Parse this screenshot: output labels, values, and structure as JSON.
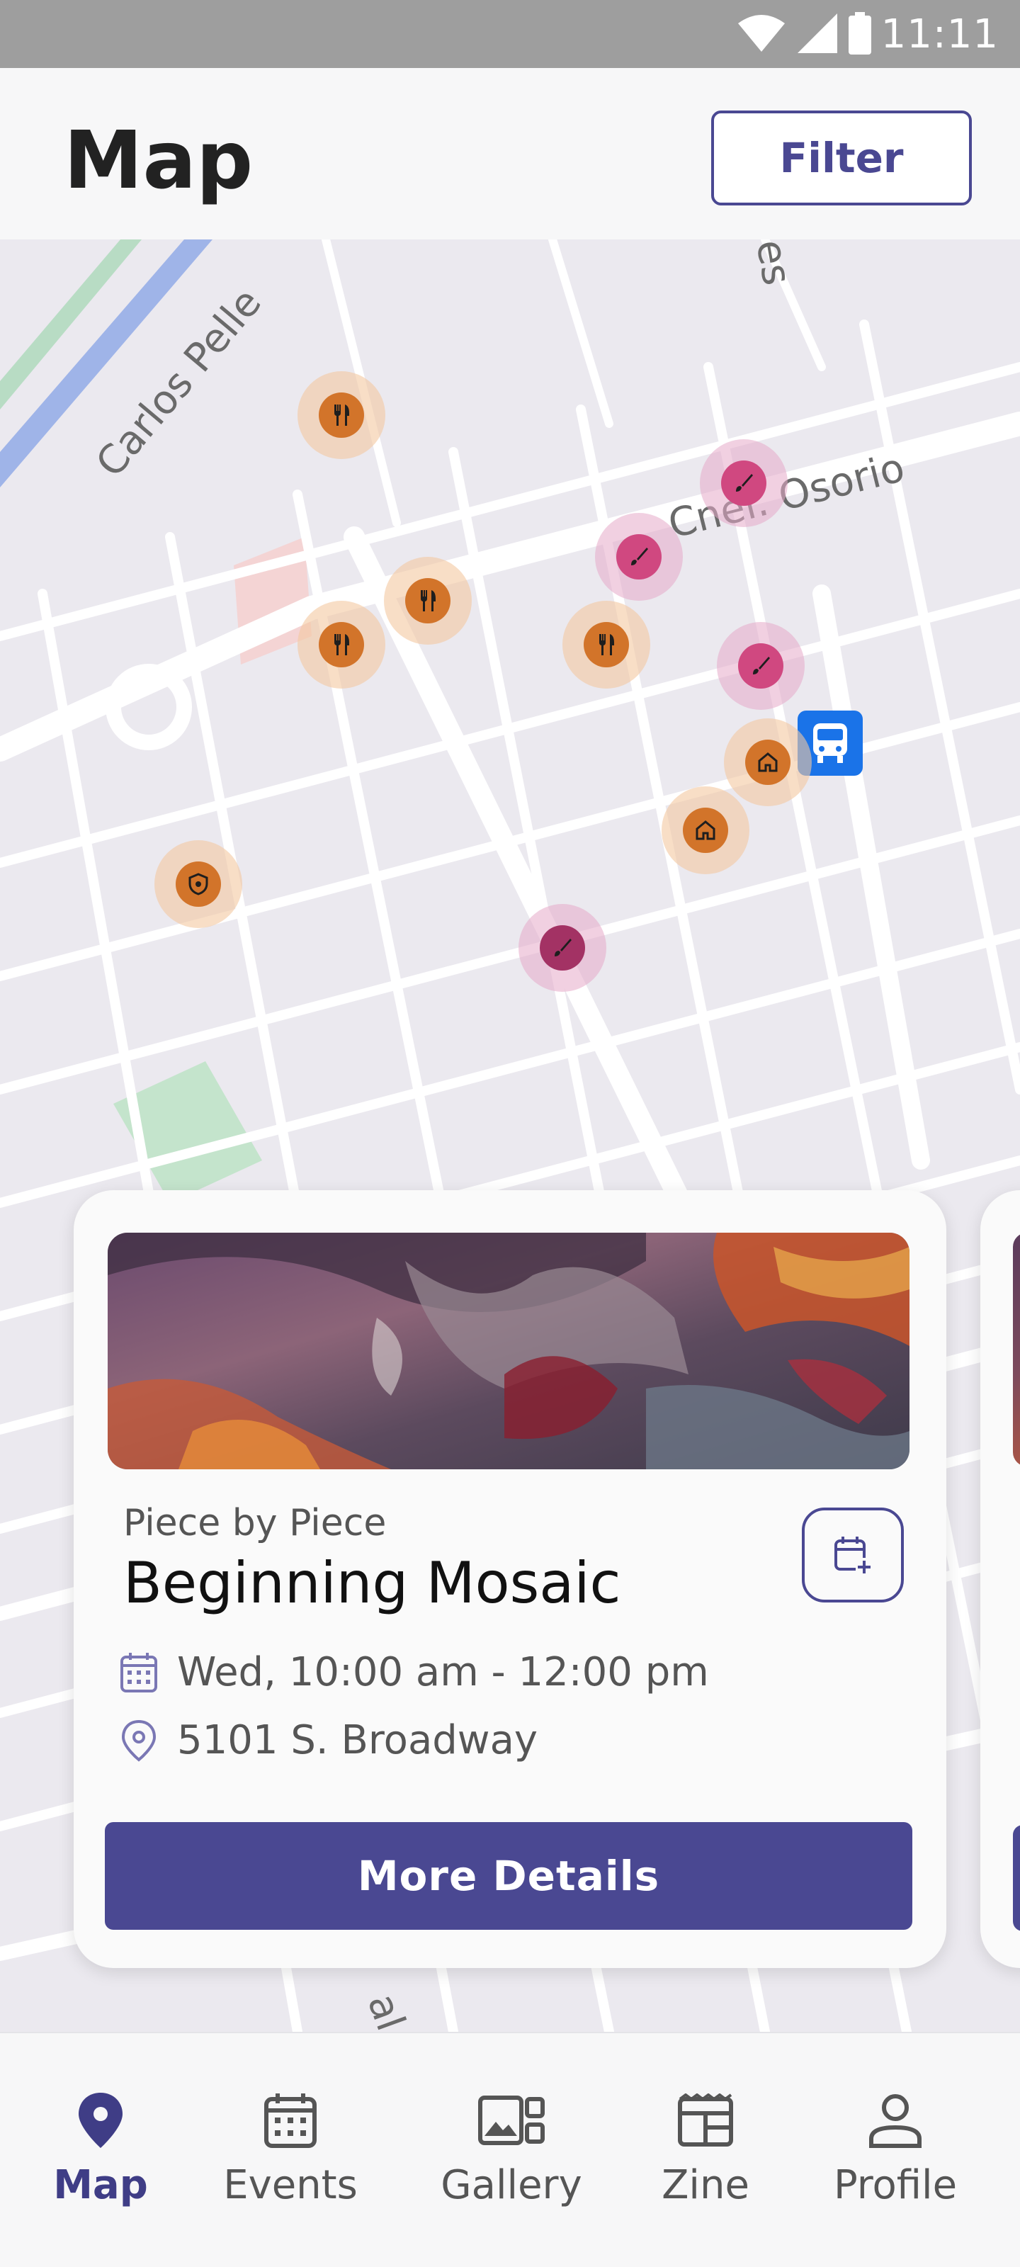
{
  "status_bar": {
    "time": "11:11",
    "icons": [
      "wifi-icon",
      "signal-icon",
      "battery-icon"
    ]
  },
  "header": {
    "title": "Map",
    "filter_label": "Filter"
  },
  "map": {
    "street_labels": [
      "Carlos Pelle",
      "Cnel. Osorio",
      "es",
      "al"
    ],
    "pins": [
      {
        "type": "food",
        "icon": "fork-knife-icon"
      },
      {
        "type": "art",
        "icon": "brush-icon"
      },
      {
        "type": "art",
        "icon": "brush-icon"
      },
      {
        "type": "food",
        "icon": "fork-knife-icon"
      },
      {
        "type": "food",
        "icon": "fork-knife-icon"
      },
      {
        "type": "food",
        "icon": "fork-knife-icon"
      },
      {
        "type": "art",
        "icon": "brush-icon"
      },
      {
        "type": "home",
        "icon": "home-icon"
      },
      {
        "type": "home",
        "icon": "home-icon"
      },
      {
        "type": "shield",
        "icon": "shield-icon"
      },
      {
        "type": "art",
        "icon": "brush-icon"
      }
    ],
    "transit_icon": "bus-icon"
  },
  "event_card": {
    "organizer": "Piece by Piece",
    "title": "Beginning Mosaic",
    "when": "Wed, 10:00 am - 12:00 pm",
    "where": "5101 S. Broadway",
    "details_label": "More Details",
    "add_to_calendar_icon": "calendar-add-icon"
  },
  "bottom_nav": {
    "active": "Map",
    "items": [
      {
        "label": "Map",
        "icon": "map-pin-icon"
      },
      {
        "label": "Events",
        "icon": "calendar-icon"
      },
      {
        "label": "Gallery",
        "icon": "gallery-icon"
      },
      {
        "label": "Zine",
        "icon": "zine-icon"
      },
      {
        "label": "Profile",
        "icon": "profile-icon"
      }
    ]
  },
  "colors": {
    "primary": "#4a4892",
    "food_pin": "#d2742a",
    "art_pin": "#d04880"
  }
}
